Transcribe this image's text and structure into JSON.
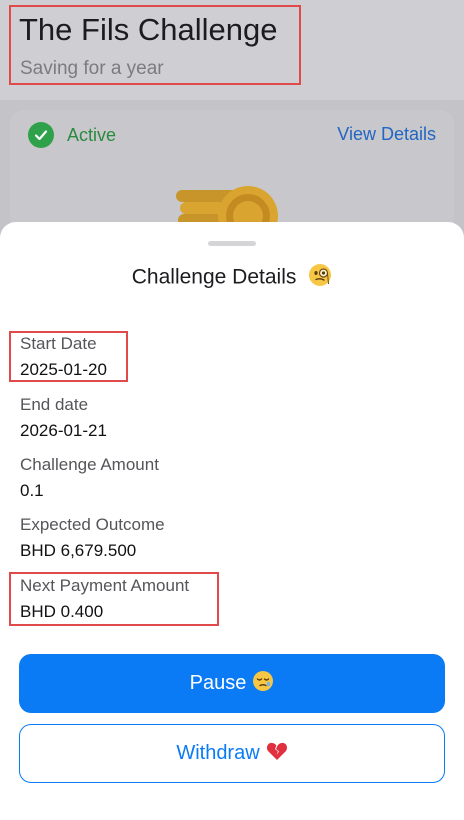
{
  "header": {
    "title": "The Fils Challenge",
    "subtitle": "Saving for a year"
  },
  "card": {
    "status": "Active",
    "view_details": "View Details",
    "icons": {
      "status": "check-circle-icon",
      "illustration": "coins-icon"
    }
  },
  "sheet": {
    "title": "Challenge Details",
    "title_icon": "monocle-face-icon",
    "details": [
      {
        "label": "Start Date",
        "value": "2025-01-20"
      },
      {
        "label": "End date",
        "value": "2026-01-21"
      },
      {
        "label": "Challenge Amount",
        "value": "0.1"
      },
      {
        "label": "Expected Outcome",
        "value": "BHD 6,679.500"
      },
      {
        "label": "Next Payment Amount",
        "value": "BHD 0.400"
      }
    ],
    "pause_label": "Pause",
    "pause_icon": "sleepy-face-icon",
    "withdraw_label": "Withdraw",
    "withdraw_icon": "broken-heart-icon"
  },
  "colors": {
    "accent": "#0a7bf5",
    "active_green": "#2ea14a",
    "highlight_red": "#e04a4a"
  }
}
